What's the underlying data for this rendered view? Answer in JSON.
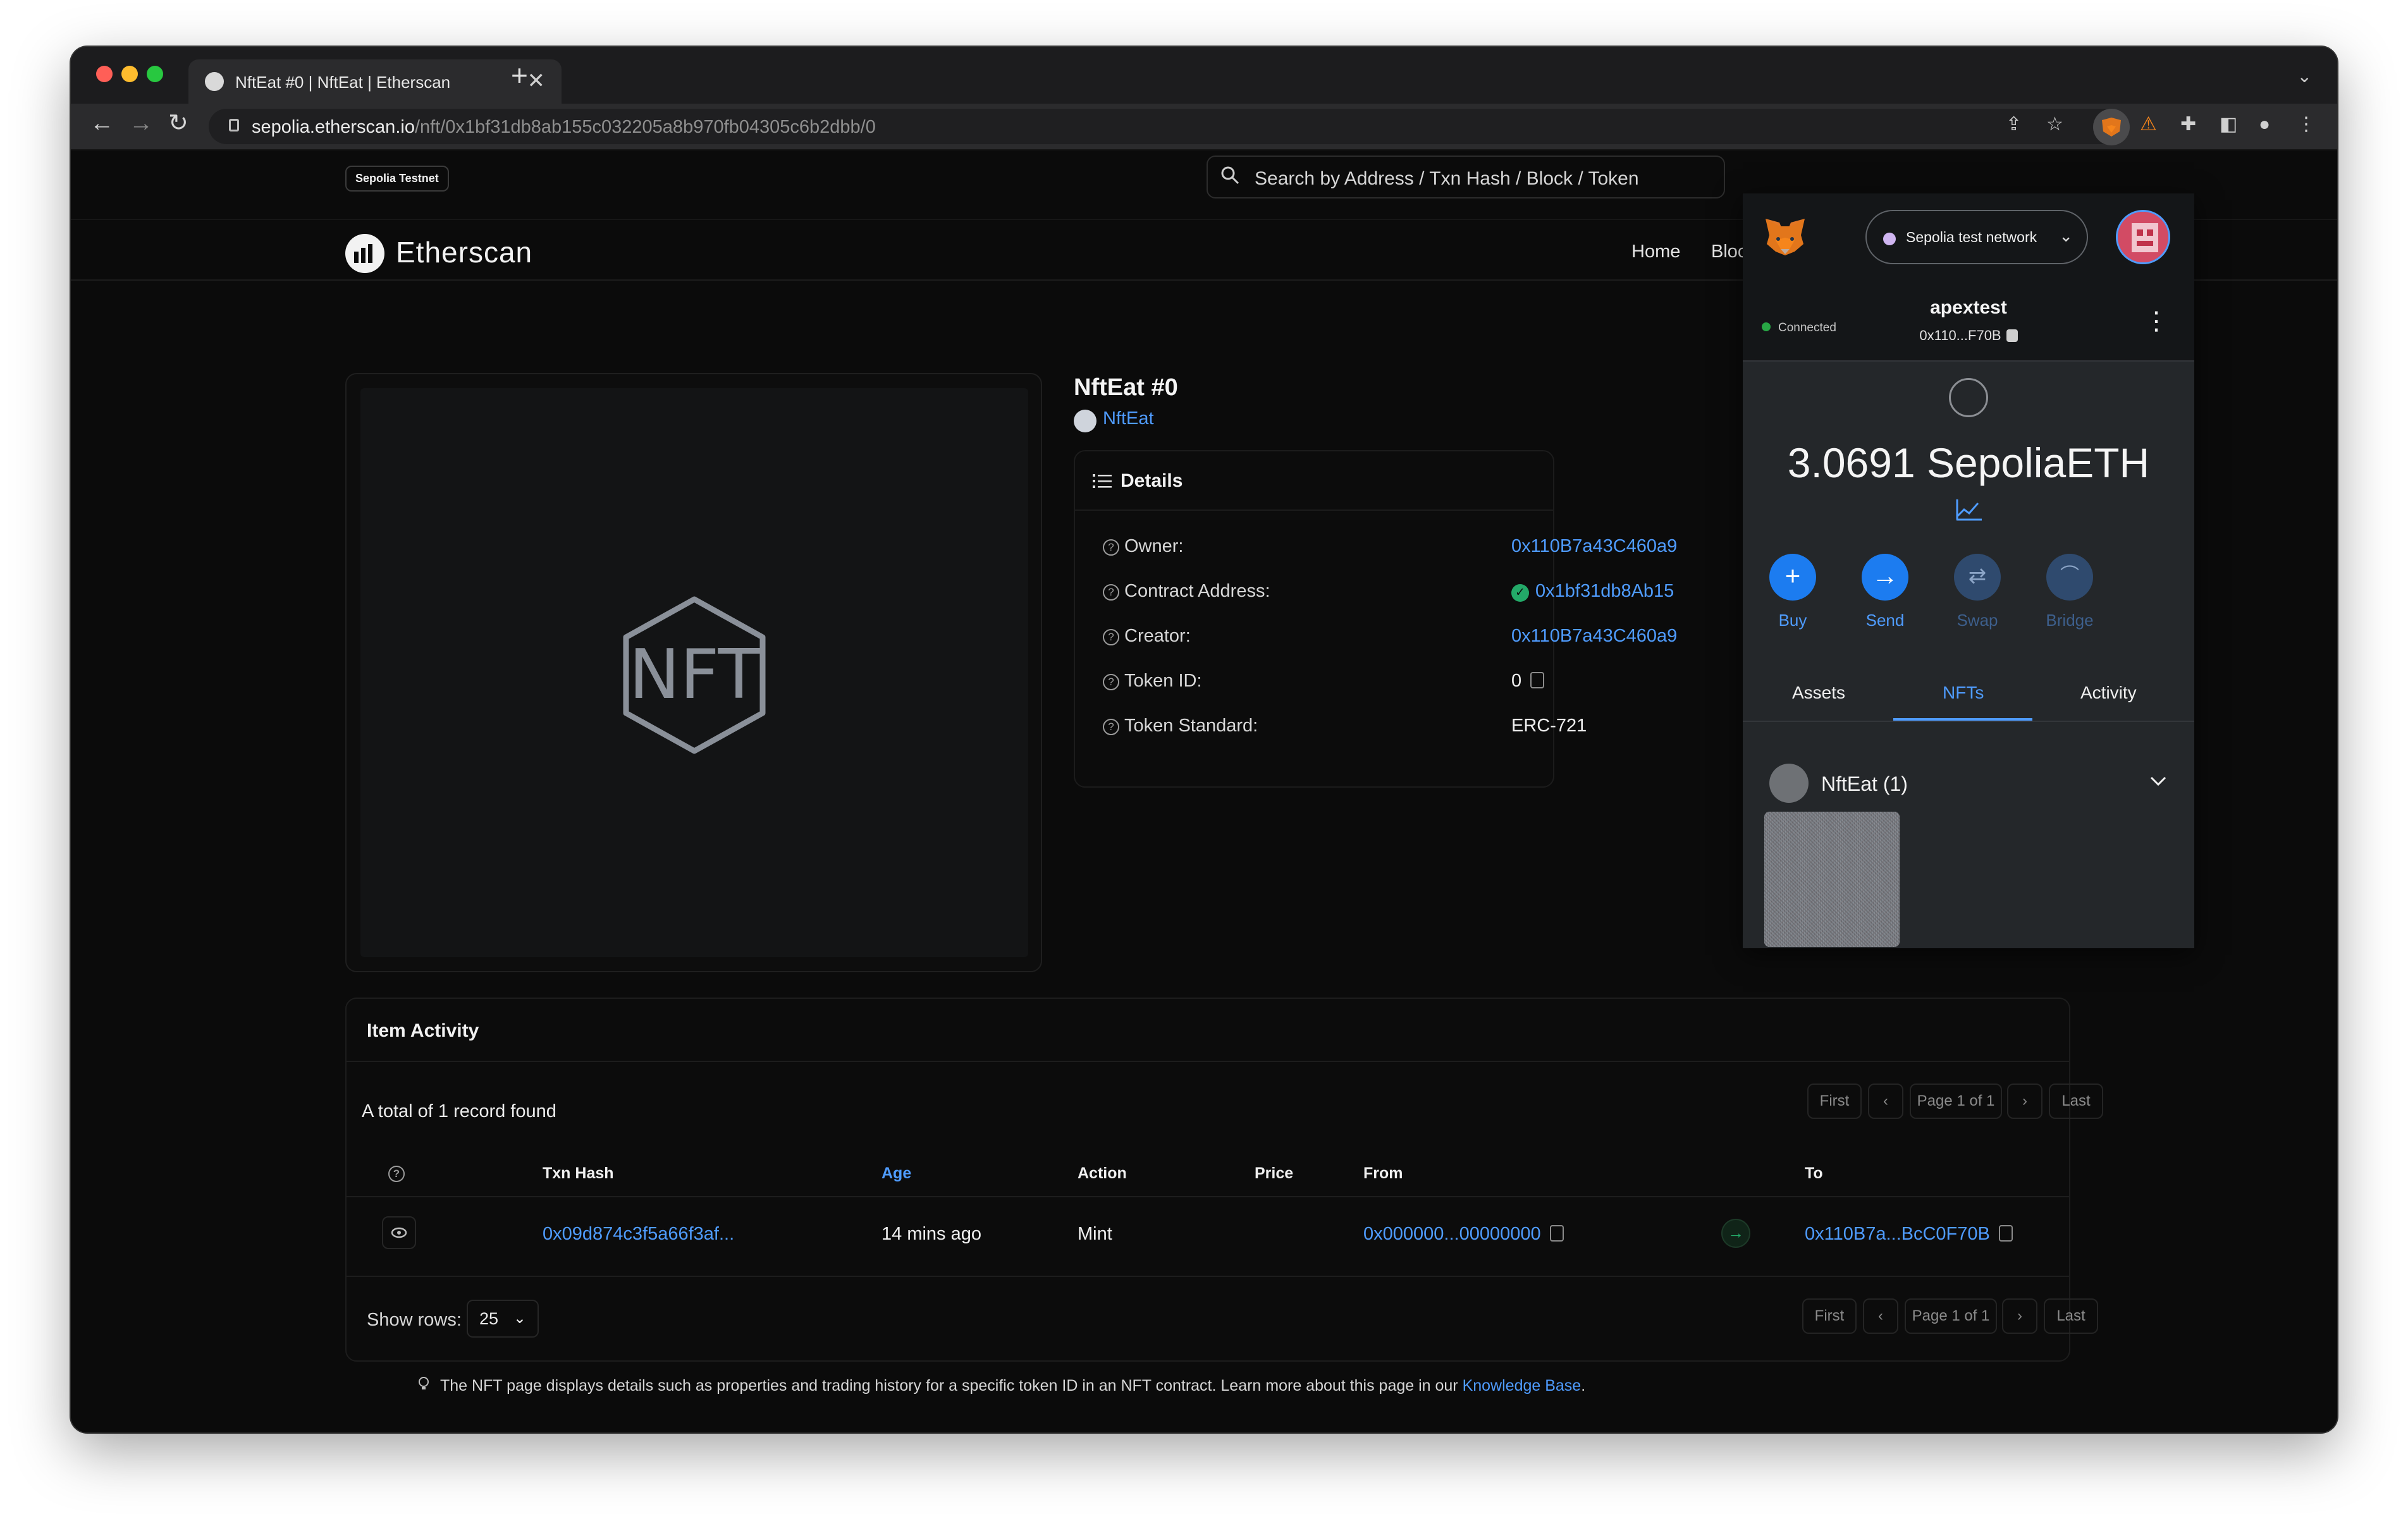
{
  "browser": {
    "tab_title": "NftEat #0 | NftEat | Etherscan",
    "tab_close": "✕",
    "new_tab": "+",
    "url_host": "sepolia.etherscan.io",
    "url_path": "/nft/0x1bf31db8ab155c032205a8b970fb04305c6b2dbb/0"
  },
  "etherscan": {
    "network_badge": "Sepolia Testnet",
    "search_placeholder": "Search by Address / Txn Hash / Block / Token",
    "logo_text": "Etherscan",
    "nav": {
      "home": "Home",
      "blockchain": "Bloc"
    },
    "nft_image_text": "NFT",
    "nft_title": "NftEat #0",
    "collection": "NftEat",
    "details": {
      "title": "Details",
      "rows": [
        {
          "label": "Owner:",
          "value": "0x110B7a43C460a9"
        },
        {
          "label": "Contract Address:",
          "value": "0x1bf31db8Ab15"
        },
        {
          "label": "Creator:",
          "value": "0x110B7a43C460a9"
        },
        {
          "label": "Token ID:",
          "value": "0"
        },
        {
          "label": "Token Standard:",
          "value": "ERC-721"
        }
      ]
    },
    "activity": {
      "title": "Item Activity",
      "total": "A total of 1 record found",
      "pager": {
        "first": "First",
        "prev": "‹",
        "page": "Page 1 of 1",
        "next": "›",
        "last": "Last"
      },
      "columns": {
        "info": "?",
        "txn_hash": "Txn Hash",
        "age": "Age",
        "action": "Action",
        "price": "Price",
        "from": "From",
        "to": "To"
      },
      "row": {
        "txn_hash": "0x09d874c3f5a66f3af...",
        "age": "14 mins ago",
        "action": "Mint",
        "price": "",
        "from": "0x000000...00000000",
        "to": "0x110B7a...BcC0F70B"
      },
      "show_rows_label": "Show rows:",
      "show_rows_value": "25"
    },
    "footnote_text": "The NFT page displays details such as properties and trading history for a specific token ID in an NFT contract. Learn more about this page in our ",
    "footnote_link": "Knowledge Base",
    "footnote_end": "."
  },
  "metamask": {
    "network": "Sepolia test network",
    "connected": "Connected",
    "account_name": "apextest",
    "account_addr": "0x110...F70B",
    "balance": "3.0691 SepoliaETH",
    "actions": {
      "buy": "Buy",
      "send": "Send",
      "swap": "Swap",
      "bridge": "Bridge"
    },
    "tabs": {
      "assets": "Assets",
      "nfts": "NFTs",
      "activity": "Activity"
    },
    "collection_label": "NftEat (1)"
  },
  "colors": {
    "accent_blue": "#4f9cff",
    "verified_green": "#23a968",
    "metamask_bg": "#24272a",
    "page_bg": "#0b0b0b"
  }
}
